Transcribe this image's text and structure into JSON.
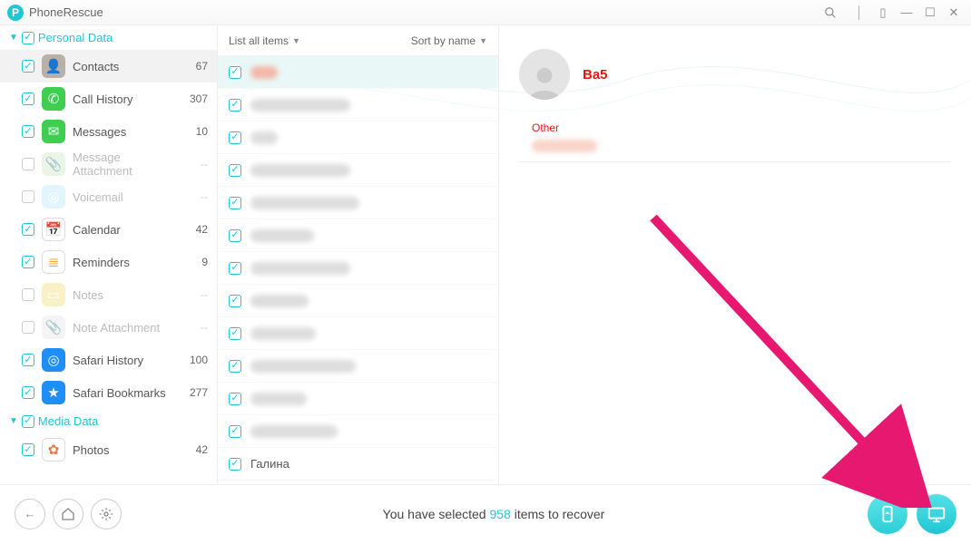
{
  "app_name": "PhoneRescue",
  "groups": [
    {
      "label": "Personal Data",
      "expanded": true,
      "checked": true
    },
    {
      "label": "Media Data",
      "expanded": true,
      "checked": true
    }
  ],
  "categories": [
    {
      "label": "Contacts",
      "count": "67",
      "checked": true,
      "selected": true,
      "disabled": false,
      "bg": "#b9b1a7",
      "glyph": "👤"
    },
    {
      "label": "Call History",
      "count": "307",
      "checked": true,
      "selected": false,
      "disabled": false,
      "bg": "#3fce4f",
      "glyph": "✆"
    },
    {
      "label": "Messages",
      "count": "10",
      "checked": true,
      "selected": false,
      "disabled": false,
      "bg": "#3fce4f",
      "glyph": "✉"
    },
    {
      "label": "Message Attachment",
      "count": "--",
      "checked": false,
      "selected": false,
      "disabled": true,
      "bg": "#dff0d8",
      "glyph": "📎"
    },
    {
      "label": "Voicemail",
      "count": "--",
      "checked": false,
      "selected": false,
      "disabled": true,
      "bg": "#cfeffb",
      "glyph": "◎"
    },
    {
      "label": "Calendar",
      "count": "42",
      "checked": true,
      "selected": false,
      "disabled": false,
      "bg": "#ffffff",
      "glyph": "📅",
      "fg": "#d33"
    },
    {
      "label": "Reminders",
      "count": "9",
      "checked": true,
      "selected": false,
      "disabled": false,
      "bg": "#ffffff",
      "glyph": "≣",
      "fg": "#f6a623"
    },
    {
      "label": "Notes",
      "count": "--",
      "checked": false,
      "selected": false,
      "disabled": true,
      "bg": "#f7e7a1",
      "glyph": "▭"
    },
    {
      "label": "Note Attachment",
      "count": "--",
      "checked": false,
      "selected": false,
      "disabled": true,
      "bg": "#eee",
      "glyph": "📎"
    },
    {
      "label": "Safari History",
      "count": "100",
      "checked": true,
      "selected": false,
      "disabled": false,
      "bg": "#1f8ef7",
      "glyph": "◎"
    },
    {
      "label": "Safari Bookmarks",
      "count": "277",
      "checked": true,
      "selected": false,
      "disabled": false,
      "bg": "#1f8ef7",
      "glyph": "★"
    }
  ],
  "media_categories": [
    {
      "label": "Photos",
      "count": "42",
      "checked": true,
      "selected": false,
      "disabled": false,
      "bg": "#ffffff",
      "glyph": "✿",
      "fg": "#e74"
    }
  ],
  "list_header": {
    "left": "List all items",
    "right": "Sort by name"
  },
  "items": [
    {
      "selected": true,
      "blurw": 30,
      "text": ""
    },
    {
      "selected": false,
      "blurw": 110,
      "text": ""
    },
    {
      "selected": false,
      "blurw": 30,
      "text": ""
    },
    {
      "selected": false,
      "blurw": 110,
      "text": ""
    },
    {
      "selected": false,
      "blurw": 120,
      "text": ""
    },
    {
      "selected": false,
      "blurw": 70,
      "text": ""
    },
    {
      "selected": false,
      "blurw": 110,
      "text": ""
    },
    {
      "selected": false,
      "blurw": 64,
      "text": ""
    },
    {
      "selected": false,
      "blurw": 72,
      "text": ""
    },
    {
      "selected": false,
      "blurw": 116,
      "text": ""
    },
    {
      "selected": false,
      "blurw": 62,
      "text": ""
    },
    {
      "selected": false,
      "blurw": 96,
      "text": ""
    },
    {
      "selected": false,
      "blurw": 0,
      "text": "Галина"
    }
  ],
  "detail": {
    "name": "Ba5",
    "field_label": "Other"
  },
  "footer": {
    "pre": "You have selected ",
    "count": "958",
    "post": " items to recover"
  }
}
